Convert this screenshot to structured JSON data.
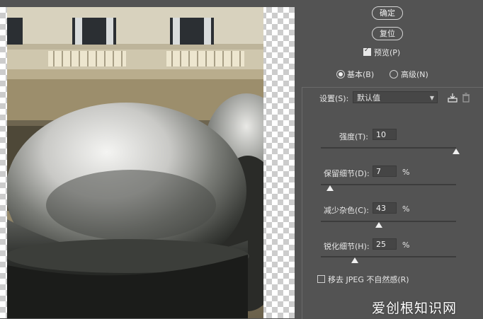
{
  "buttons": {
    "ok": "确定",
    "reset": "复位"
  },
  "preview": {
    "label": "预览(P)",
    "checked": true
  },
  "mode": {
    "basic": "基本(B)",
    "advanced": "高级(N)",
    "selected": "basic"
  },
  "settings": {
    "label": "设置(S):",
    "value": "默认值",
    "icons": [
      "save-preset-icon",
      "trash-icon"
    ]
  },
  "sliders": {
    "strength": {
      "label": "强度(T):",
      "value": "10",
      "unit": "",
      "level": 1.0
    },
    "preserve_detail": {
      "label": "保留细节(D):",
      "value": "7",
      "unit": "%",
      "level": 0.07
    },
    "reduce_color": {
      "label": "减少杂色(C):",
      "value": "43",
      "unit": "%",
      "level": 0.43
    },
    "sharpen": {
      "label": "锐化细节(H):",
      "value": "25",
      "unit": "%",
      "level": 0.25
    }
  },
  "jpeg": {
    "label": "移去 JPEG 不自然感(R)",
    "checked": false
  },
  "watermark": "爱创根知识网",
  "colors": {
    "panel": "#535353",
    "field": "#454545",
    "text": "#e6e6e6"
  }
}
